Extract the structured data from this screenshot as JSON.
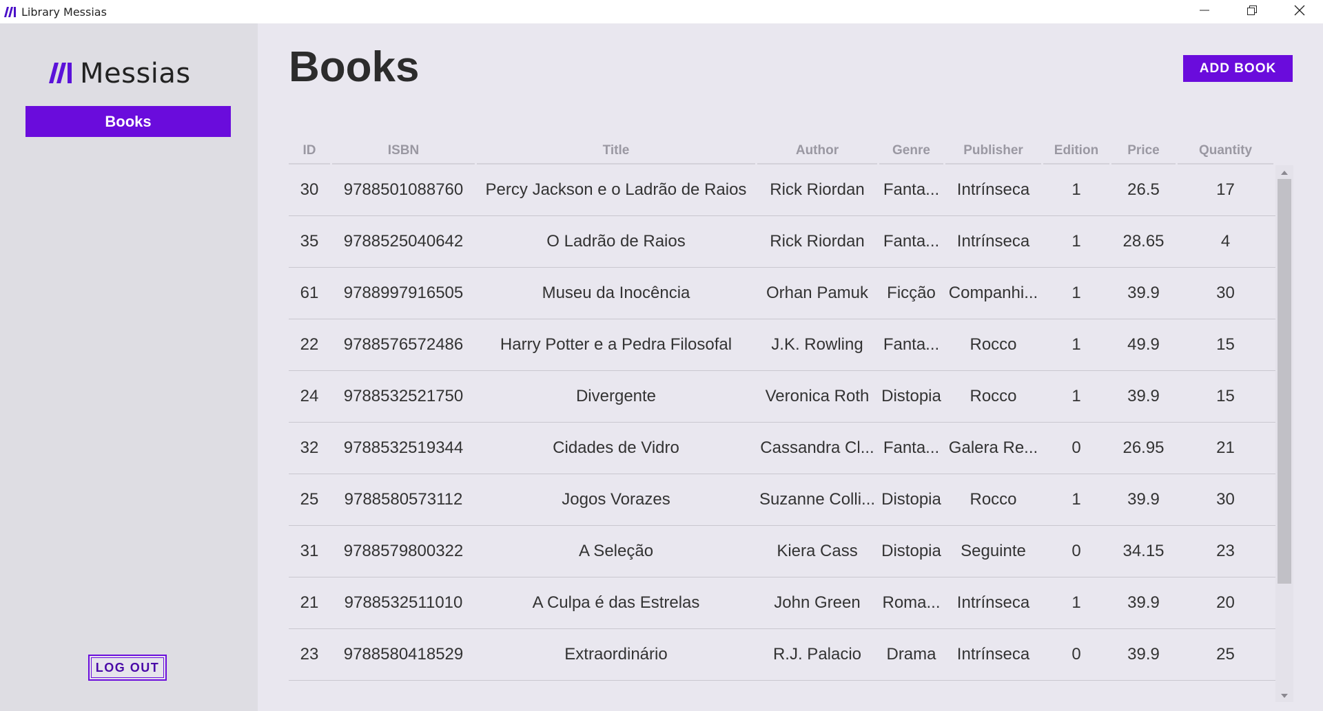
{
  "window": {
    "title": "Library Messias",
    "controls": [
      "minimize-icon",
      "restore-icon",
      "close-icon"
    ]
  },
  "sidebar": {
    "logo_text": "Messias",
    "nav_items": [
      {
        "label": "Books",
        "active": true
      }
    ],
    "logout_label": "LOG OUT"
  },
  "main": {
    "title": "Books",
    "add_button_label": "ADD BOOK"
  },
  "colors": {
    "accent": "#6a0cdc",
    "background": "#e9e7ef",
    "sidebar": "#dedde3"
  },
  "table": {
    "columns": [
      "ID",
      "ISBN",
      "Title",
      "Author",
      "Genre",
      "Publisher",
      "Edition",
      "Price",
      "Quantity"
    ],
    "rows": [
      [
        "30",
        "9788501088760",
        "Percy Jackson e o Ladrão de Raios",
        "Rick Riordan",
        "Fanta...",
        "Intrínseca",
        "1",
        "26.5",
        "17"
      ],
      [
        "35",
        "9788525040642",
        "O Ladrão de Raios",
        "Rick Riordan",
        "Fanta...",
        "Intrínseca",
        "1",
        "28.65",
        "4"
      ],
      [
        "61",
        "9788997916505",
        "Museu da Inocência",
        "Orhan Pamuk",
        "Ficção",
        "Companhi...",
        "1",
        "39.9",
        "30"
      ],
      [
        "22",
        "9788576572486",
        "Harry Potter e a Pedra Filosofal",
        "J.K. Rowling",
        "Fanta...",
        "Rocco",
        "1",
        "49.9",
        "15"
      ],
      [
        "24",
        "9788532521750",
        "Divergente",
        "Veronica Roth",
        "Distopia",
        "Rocco",
        "1",
        "39.9",
        "15"
      ],
      [
        "32",
        "9788532519344",
        "Cidades de Vidro",
        "Cassandra Cl...",
        "Fanta...",
        "Galera Re...",
        "0",
        "26.95",
        "21"
      ],
      [
        "25",
        "9788580573112",
        "Jogos Vorazes",
        "Suzanne Colli...",
        "Distopia",
        "Rocco",
        "1",
        "39.9",
        "30"
      ],
      [
        "31",
        "9788579800322",
        "A Seleção",
        "Kiera Cass",
        "Distopia",
        "Seguinte",
        "0",
        "34.15",
        "23"
      ],
      [
        "21",
        "9788532511010",
        "A Culpa é das Estrelas",
        "John Green",
        "Roma...",
        "Intrínseca",
        "1",
        "39.9",
        "20"
      ],
      [
        "23",
        "9788580418529",
        "Extraordinário",
        "R.J. Palacio",
        "Drama",
        "Intrínseca",
        "0",
        "39.9",
        "25"
      ]
    ],
    "scroll_position": 0.0
  }
}
